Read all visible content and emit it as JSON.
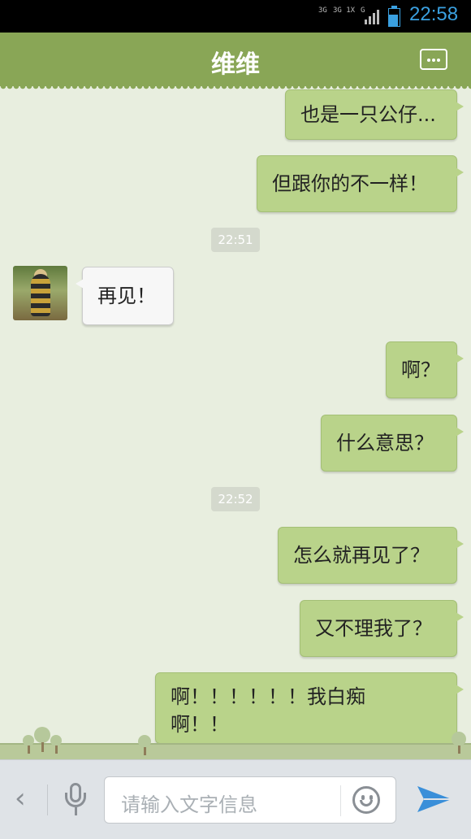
{
  "status_bar": {
    "network_labels": [
      "3G",
      "3G 1X",
      "G"
    ],
    "time": "22:58"
  },
  "header": {
    "title": "维维",
    "more_icon": "more-dots-icon"
  },
  "chat": {
    "messages": [
      {
        "side": "out",
        "text": "也是一只公仔..."
      },
      {
        "side": "out",
        "text": "但跟你的不一样！"
      },
      {
        "timestamp": "22:51"
      },
      {
        "side": "in",
        "text": "再见！"
      },
      {
        "side": "out",
        "text": "啊？"
      },
      {
        "side": "out",
        "text": "什么意思？"
      },
      {
        "timestamp": "22:52"
      },
      {
        "side": "out",
        "text": "怎么就再见了？"
      },
      {
        "side": "out",
        "text": "又不理我了？"
      },
      {
        "side": "out",
        "lines": [
          "啊！！！！！！我白痴",
          "啊！！"
        ]
      }
    ]
  },
  "input_bar": {
    "placeholder": "请输入文字信息",
    "icons": [
      "chevron-left-icon",
      "microphone-icon",
      "smiley-icon",
      "send-icon"
    ]
  },
  "colors": {
    "header_bg": "#89a656",
    "chat_bg": "#e8eedf",
    "outgoing_bubble": "#b9d38a",
    "incoming_bubble": "#f7f7f7",
    "clock": "#3aa0e0",
    "send_icon": "#3a8fd9"
  }
}
